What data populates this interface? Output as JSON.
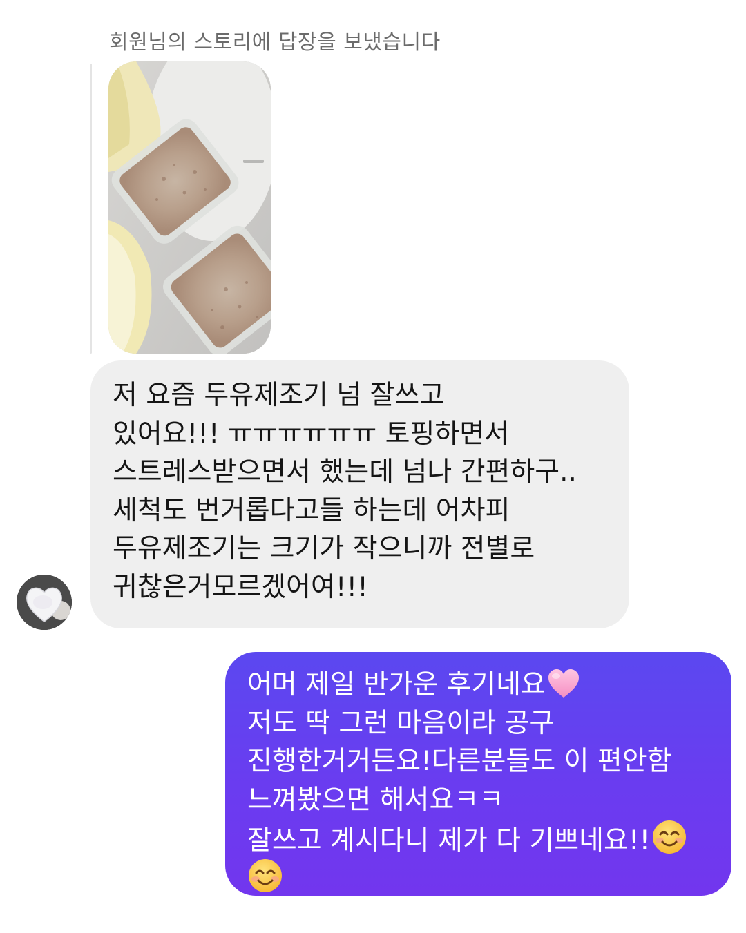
{
  "reply_note": "회원님의 스토리에 답장을 보냈습니다",
  "incoming_message": {
    "lines": [
      "저 요즘 두유제조기 넘 잘쓰고",
      "있어요!!! ㅠㅠㅠㅠㅠㅠ 토핑하면서",
      "스트레스받으면서 했는데 넘나 간편하구..",
      "세척도 번거롭다고들 하는데 어차피",
      "두유제조기는 크기가 작으니까 전별로",
      "귀찮은거모르겠어여!!!"
    ]
  },
  "outgoing_message": {
    "lines": [
      "어머 제일 반가운 후기네요",
      "저도 딱 그런 마음이라 공구",
      "진행한거거든요!다른분들도 이 편안함",
      "느껴봤으면 해서요ㅋㅋ",
      "잘쓰고 계시다니 제가 다 기쁘네요!!",
      ""
    ],
    "emojis": {
      "heart": "pink-heart-emoji",
      "smile": "smiling-face-emoji"
    }
  },
  "colors": {
    "incoming_bubble": "#efefef",
    "outgoing_bubble": "#6341f0",
    "meta_text": "#6b6b6b"
  }
}
